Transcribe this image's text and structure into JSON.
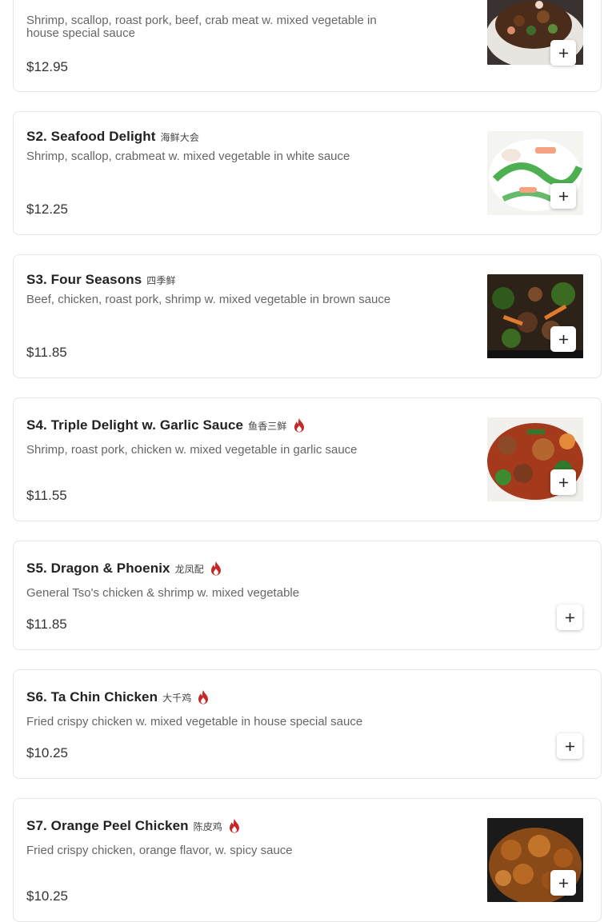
{
  "accent_color": "#c62828",
  "items": [
    {
      "id": "s1",
      "name": "",
      "cn": "",
      "description": "Shrimp, scallop, roast pork, beef, crab meat w. mixed vegetable in house special sauce",
      "price": "$12.95",
      "spicy": false,
      "has_photo": true,
      "photo_icon": "stir-fry-dish-photo"
    },
    {
      "id": "s2",
      "name": "S2. Seafood Delight",
      "cn": "海鲜大会",
      "description": "Shrimp, scallop, crabmeat w. mixed vegetable in white sauce",
      "price": "$12.25",
      "spicy": false,
      "has_photo": true,
      "photo_icon": "seafood-dish-photo"
    },
    {
      "id": "s3",
      "name": "S3. Four Seasons",
      "cn": "四季鲜",
      "description": "Beef, chicken, roast pork, shrimp w. mixed vegetable in brown sauce",
      "price": "$11.85",
      "spicy": false,
      "has_photo": true,
      "photo_icon": "brown-sauce-dish-photo"
    },
    {
      "id": "s4",
      "name": "S4. Triple Delight w. Garlic Sauce",
      "cn": "鱼香三鲜",
      "description": "Shrimp, roast pork, chicken w. mixed vegetable in garlic sauce",
      "price": "$11.55",
      "spicy": true,
      "has_photo": true,
      "photo_icon": "garlic-sauce-dish-photo"
    },
    {
      "id": "s5",
      "name": "S5. Dragon & Phoenix",
      "cn": "龙凤配",
      "description": "General Tso's chicken & shrimp w. mixed vegetable",
      "price": "$11.85",
      "spicy": true,
      "has_photo": false
    },
    {
      "id": "s6",
      "name": "S6. Ta Chin Chicken",
      "cn": "大千鸡",
      "description": "Fried crispy chicken w. mixed vegetable in house special sauce",
      "price": "$10.25",
      "spicy": true,
      "has_photo": false
    },
    {
      "id": "s7",
      "name": "S7. Orange Peel Chicken",
      "cn": "陈皮鸡",
      "description": "Fried crispy chicken, orange flavor, w. spicy sauce",
      "price": "$10.25",
      "spicy": true,
      "has_photo": true,
      "photo_icon": "orange-chicken-dish-photo"
    }
  ]
}
